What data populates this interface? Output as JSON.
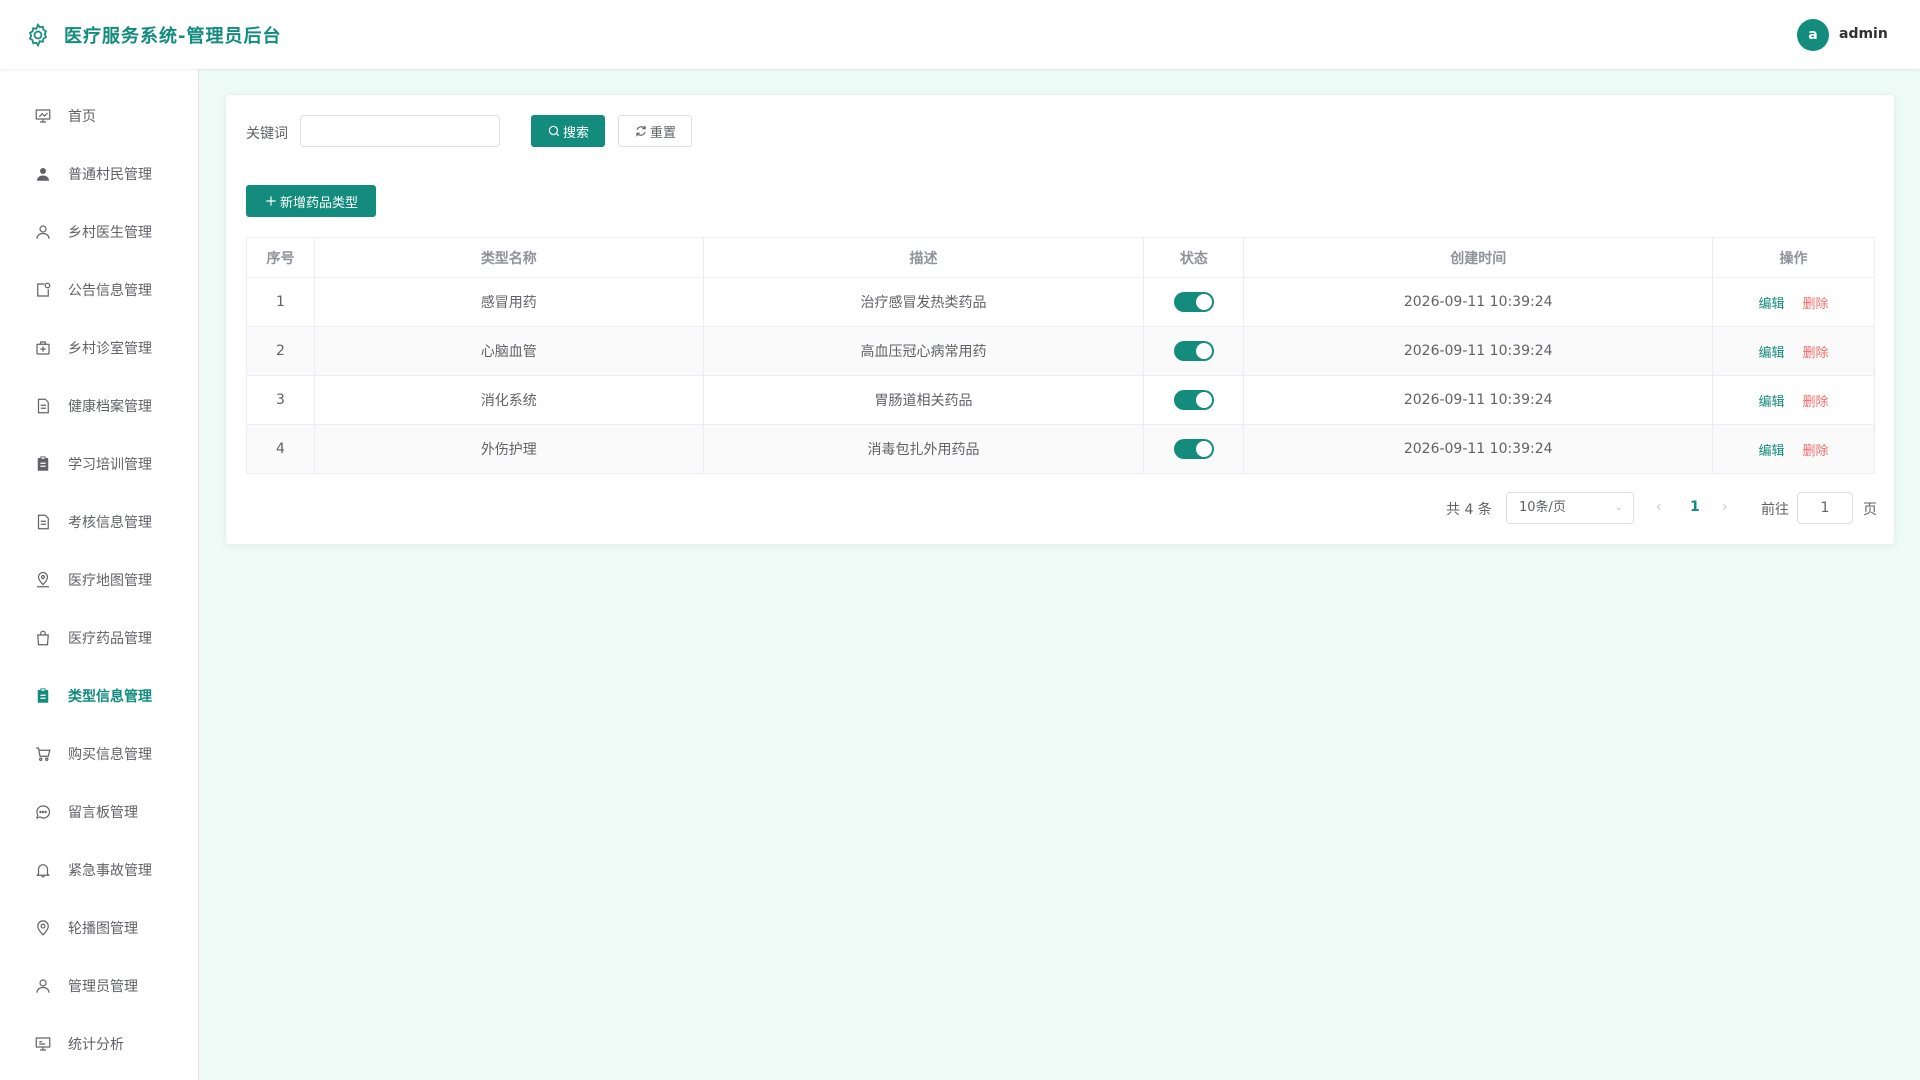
{
  "app": {
    "title": "医疗服务系统-管理员后台"
  },
  "user": {
    "avatar_letter": "a",
    "name": "admin"
  },
  "colors": {
    "brand": "#138c7e",
    "danger": "#f56c6c",
    "background": "#eefbf7"
  },
  "sidebar": {
    "items": [
      {
        "label": "首页",
        "icon": "dashboard-icon"
      },
      {
        "label": "普通村民管理",
        "icon": "user-filled-icon"
      },
      {
        "label": "乡村医生管理",
        "icon": "user-icon"
      },
      {
        "label": "公告信息管理",
        "icon": "notice-icon"
      },
      {
        "label": "乡村诊室管理",
        "icon": "first-aid-icon"
      },
      {
        "label": "健康档案管理",
        "icon": "document-icon"
      },
      {
        "label": "学习培训管理",
        "icon": "clipboard-icon"
      },
      {
        "label": "考核信息管理",
        "icon": "document-icon"
      },
      {
        "label": "医疗地图管理",
        "icon": "map-location-icon"
      },
      {
        "label": "医疗药品管理",
        "icon": "shopping-bag-icon"
      },
      {
        "label": "类型信息管理",
        "icon": "clipboard-icon",
        "active": true
      },
      {
        "label": "购买信息管理",
        "icon": "shopping-cart-icon"
      },
      {
        "label": "留言板管理",
        "icon": "chat-icon"
      },
      {
        "label": "紧急事故管理",
        "icon": "bell-icon"
      },
      {
        "label": "轮播图管理",
        "icon": "location-icon"
      },
      {
        "label": "管理员管理",
        "icon": "user-icon"
      },
      {
        "label": "统计分析",
        "icon": "data-board-icon"
      }
    ]
  },
  "search": {
    "keyword_label": "关键词",
    "keyword_value": "",
    "search_label": "搜索",
    "reset_label": "重置"
  },
  "toolbar": {
    "add_label": "新增药品类型"
  },
  "table": {
    "columns": [
      "序号",
      "类型名称",
      "描述",
      "状态",
      "创建时间",
      "操作"
    ],
    "rows": [
      {
        "index": "1",
        "name": "感冒用药",
        "desc": "治疗感冒发热类药品",
        "enabled": true,
        "created": "2026-09-11 10:39:24"
      },
      {
        "index": "2",
        "name": "心脑血管",
        "desc": "高血压冠心病常用药",
        "enabled": true,
        "created": "2026-09-11 10:39:24"
      },
      {
        "index": "3",
        "name": "消化系统",
        "desc": "胃肠道相关药品",
        "enabled": true,
        "created": "2026-09-11 10:39:24"
      },
      {
        "index": "4",
        "name": "外伤护理",
        "desc": "消毒包扎外用药品",
        "enabled": true,
        "created": "2026-09-11 10:39:24"
      }
    ],
    "edit_label": "编辑",
    "delete_label": "删除"
  },
  "pagination": {
    "total_text": "共 4 条",
    "page_size": "10条/页",
    "current_page": "1",
    "goto_label": "前往",
    "goto_value": "1",
    "page_suffix": "页"
  }
}
